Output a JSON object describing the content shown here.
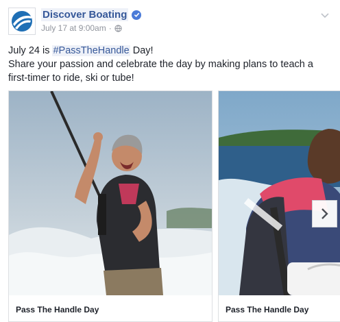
{
  "post": {
    "page_name": "Discover Boating",
    "date": "July 17 at 9:00am",
    "separator": "·",
    "text_line1_prefix": "July 24 is ",
    "hashtag": "#PassTheHandle",
    "text_line1_suffix": " Day!",
    "text_line2": "Share your passion and celebrate the day by making plans to teach a first-timer to ride, ski or tube!"
  },
  "icons": {
    "verified": "verified-badge-icon",
    "privacy": "globe-icon",
    "menu": "chevron-down-icon",
    "next": "chevron-right-icon",
    "logo": "discover-boating-logo"
  },
  "carousel": {
    "cards": [
      {
        "title": "Pass The Handle Day"
      },
      {
        "title": "Pass The Handle Day"
      }
    ]
  },
  "colors": {
    "link": "#365899",
    "verified": "#4b7bd8",
    "logo_blue": "#1f6fb5"
  }
}
